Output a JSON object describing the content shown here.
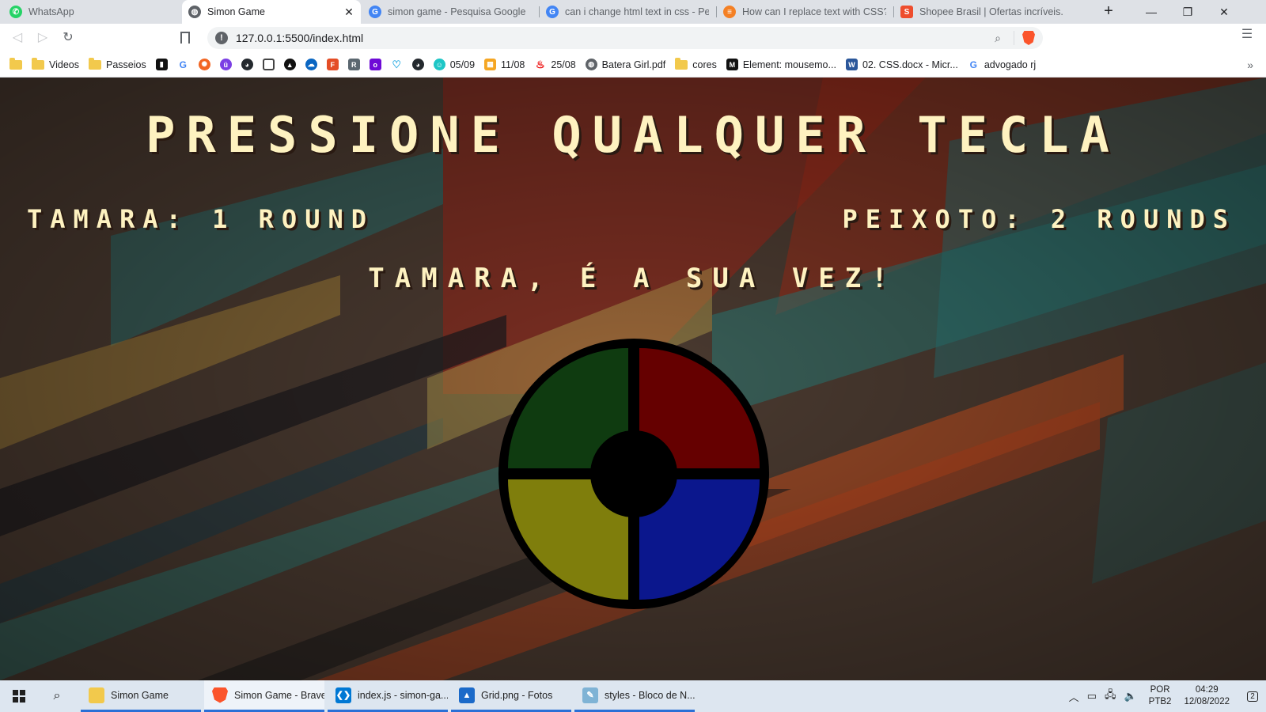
{
  "browser": {
    "tabs": [
      {
        "title": "WhatsApp",
        "icon": "whatsapp-icon",
        "color": "#25d366",
        "active": false
      },
      {
        "title": "Simon Game",
        "icon": "globe-icon",
        "color": "#5f6368",
        "active": true
      },
      {
        "title": "simon game - Pesquisa Google",
        "icon": "google-icon",
        "color": "#4285f4",
        "active": false
      },
      {
        "title": "can i change html text in css - Pesqu",
        "icon": "google-icon",
        "color": "#4285f4",
        "active": false
      },
      {
        "title": "How can I replace text with CSS? - S",
        "icon": "stackoverflow-icon",
        "color": "#f48024",
        "active": false
      },
      {
        "title": "Shopee Brasil | Ofertas incríveis. Me",
        "icon": "shopee-icon",
        "color": "#ee4d2d",
        "active": false
      }
    ],
    "new_tab": "+",
    "window_controls": {
      "minimize": "—",
      "restore": "❐",
      "close": "✕"
    },
    "url": "127.0.0.1:5500/index.html",
    "bookmarks": [
      {
        "label": "",
        "icon": "folder-icon"
      },
      {
        "label": "Videos",
        "icon": "folder-icon"
      },
      {
        "label": "Passeios",
        "icon": "folder-icon"
      },
      {
        "label": "",
        "icon": "bookmark-icon-1",
        "color": "#111111"
      },
      {
        "label": "",
        "icon": "google-icon",
        "color": "#4285f4"
      },
      {
        "label": "",
        "icon": "sun-icon",
        "color": "#f26522"
      },
      {
        "label": "",
        "icon": "u-icon",
        "color": "#7b3fe4"
      },
      {
        "label": "",
        "icon": "github-icon",
        "color": "#24292e"
      },
      {
        "label": "",
        "icon": "square-icon",
        "color": "#444444"
      },
      {
        "label": "",
        "icon": "triangle-icon",
        "color": "#111111"
      },
      {
        "label": "",
        "icon": "cloud-icon",
        "color": "#0a66c2"
      },
      {
        "label": "",
        "icon": "f-icon",
        "color": "#e44d26"
      },
      {
        "label": "",
        "icon": "r-icon",
        "color": "#5b6770"
      },
      {
        "label": "",
        "icon": "olx-icon",
        "color": "#6e0ad6"
      },
      {
        "label": "",
        "icon": "heart-icon",
        "color": "#29abe2"
      },
      {
        "label": "",
        "icon": "github-icon",
        "color": "#24292e"
      },
      {
        "label": "05/09",
        "icon": "smile-icon",
        "color": "#1ec6c6"
      },
      {
        "label": "11/08",
        "icon": "calendar-icon",
        "color": "#f5a623"
      },
      {
        "label": "25/08",
        "icon": "santander-icon",
        "color": "#ec0000"
      },
      {
        "label": "Batera Girl.pdf",
        "icon": "globe-icon",
        "color": "#5f6368"
      },
      {
        "label": "cores",
        "icon": "folder-icon"
      },
      {
        "label": "Element: mousemo...",
        "icon": "mdn-icon",
        "color": "#111111"
      },
      {
        "label": "02. CSS.docx - Micr...",
        "icon": "word-icon",
        "color": "#2b579a"
      },
      {
        "label": "advogado rj",
        "icon": "google-icon",
        "color": "#4285f4"
      }
    ],
    "bookmarks_more": "»"
  },
  "game": {
    "title": "Pressione qualquer tecla",
    "score_left": "Tamara: 1 round",
    "score_right": "Peixoto: 2 rounds",
    "turn": "Tamara, é a sua vez!",
    "pads": [
      {
        "name": "green",
        "color": "#0f3b10"
      },
      {
        "name": "red",
        "color": "#650000"
      },
      {
        "name": "yellow",
        "color": "#7f7e0c"
      },
      {
        "name": "blue",
        "color": "#0b178d"
      }
    ]
  },
  "taskbar": {
    "tasks": [
      {
        "label": "Simon Game",
        "icon": "folder-icon",
        "color": "#f2c94c",
        "active": false
      },
      {
        "label": "Simon Game - Brave",
        "icon": "brave-icon",
        "color": "#fb542b",
        "active": true
      },
      {
        "label": "index.js - simon-ga...",
        "icon": "vscode-icon",
        "color": "#0078d4",
        "active": false
      },
      {
        "label": "Grid.png - Fotos",
        "icon": "photos-icon",
        "color": "#1b6ac9",
        "active": false
      },
      {
        "label": "styles - Bloco de N...",
        "icon": "notepad-icon",
        "color": "#7fb3d5",
        "active": false
      }
    ],
    "lang": "POR",
    "layout": "PTB2",
    "time": "04:29",
    "date": "12/08/2022",
    "notifications": "2"
  }
}
